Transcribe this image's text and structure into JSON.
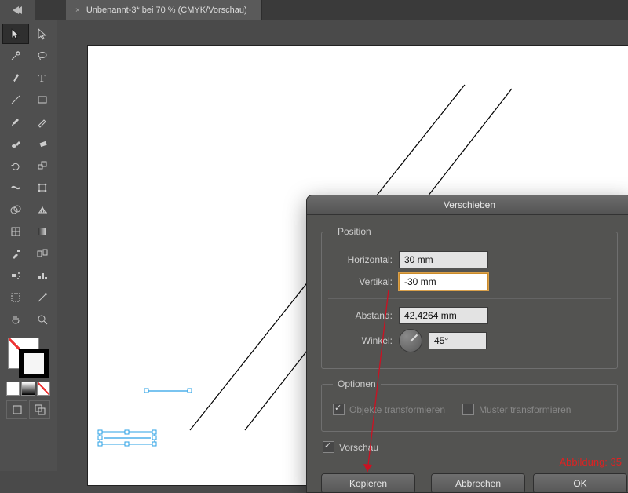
{
  "tab": {
    "title": "Unbenannt-3* bei 70 % (CMYK/Vorschau)"
  },
  "dialog": {
    "title": "Verschieben",
    "groups": {
      "position": "Position",
      "options": "Optionen"
    },
    "labels": {
      "horizontal": "Horizontal:",
      "vertikal": "Vertikal:",
      "abstand": "Abstand:",
      "winkel": "Winkel:"
    },
    "values": {
      "horizontal": "30 mm",
      "vertikal": "-30 mm",
      "abstand": "42,4264 mm",
      "winkel": "45°"
    },
    "options": {
      "objekte_label": "Objekte transformieren",
      "objekte_checked": true,
      "muster_label": "Muster transformieren",
      "muster_checked": false
    },
    "vorschau_label": "Vorschau",
    "vorschau_checked": true,
    "buttons": {
      "kopieren": "Kopieren",
      "abbrechen": "Abbrechen",
      "ok": "OK"
    }
  },
  "caption": "Abbildung: 35"
}
